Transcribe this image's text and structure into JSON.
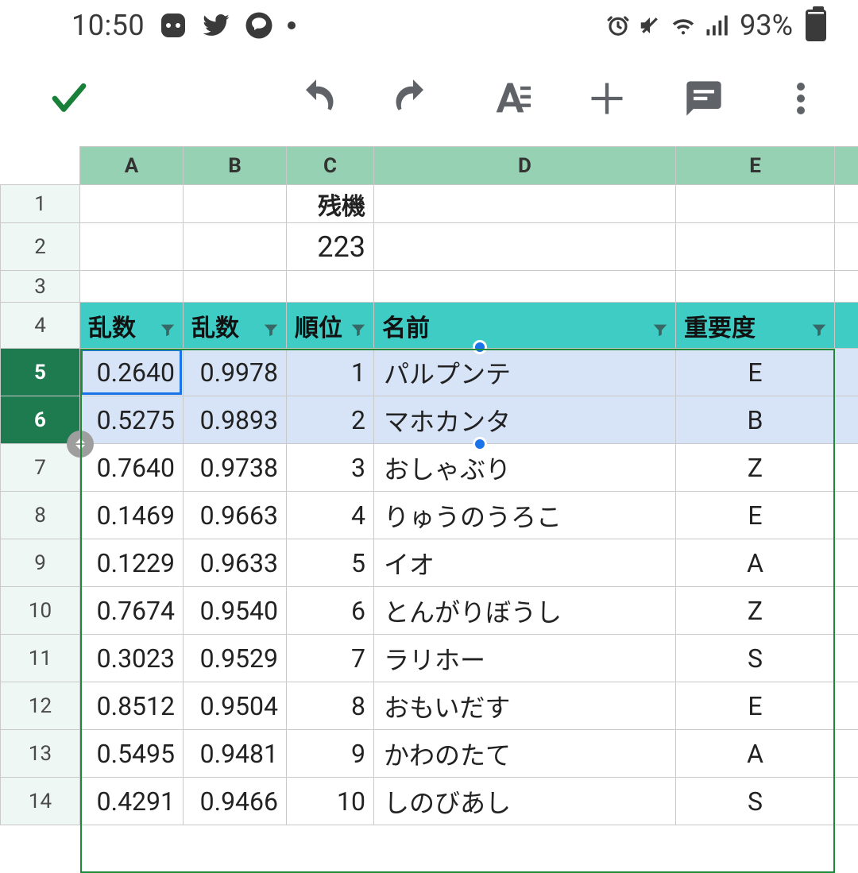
{
  "status": {
    "time": "10:50",
    "battery_pct": "93%"
  },
  "sheet": {
    "col_labels": [
      "A",
      "B",
      "C",
      "D",
      "E"
    ],
    "c1_label": "残機",
    "c2_value": "223",
    "headers": {
      "a": "乱数",
      "b": "乱数",
      "c": "順位",
      "d": "名前",
      "e": "重要度"
    },
    "rows": [
      {
        "n": 5,
        "a": "0.2640",
        "b": "0.9978",
        "c": "1",
        "d": "パルプンテ",
        "e": "E",
        "sel": true
      },
      {
        "n": 6,
        "a": "0.5275",
        "b": "0.9893",
        "c": "2",
        "d": "マホカンタ",
        "e": "B",
        "sel": true
      },
      {
        "n": 7,
        "a": "0.7640",
        "b": "0.9738",
        "c": "3",
        "d": "おしゃぶり",
        "e": "Z"
      },
      {
        "n": 8,
        "a": "0.1469",
        "b": "0.9663",
        "c": "4",
        "d": "りゅうのうろこ",
        "e": "E"
      },
      {
        "n": 9,
        "a": "0.1229",
        "b": "0.9633",
        "c": "5",
        "d": "イオ",
        "e": "A"
      },
      {
        "n": 10,
        "a": "0.7674",
        "b": "0.9540",
        "c": "6",
        "d": "とんがりぼうし",
        "e": "Z"
      },
      {
        "n": 11,
        "a": "0.3023",
        "b": "0.9529",
        "c": "7",
        "d": "ラリホー",
        "e": "S"
      },
      {
        "n": 12,
        "a": "0.8512",
        "b": "0.9504",
        "c": "8",
        "d": "おもいだす",
        "e": "E"
      },
      {
        "n": 13,
        "a": "0.5495",
        "b": "0.9481",
        "c": "9",
        "d": "かわのたて",
        "e": "A"
      },
      {
        "n": 14,
        "a": "0.4291",
        "b": "0.9466",
        "c": "10",
        "d": "しのびあし",
        "e": "S"
      }
    ]
  }
}
